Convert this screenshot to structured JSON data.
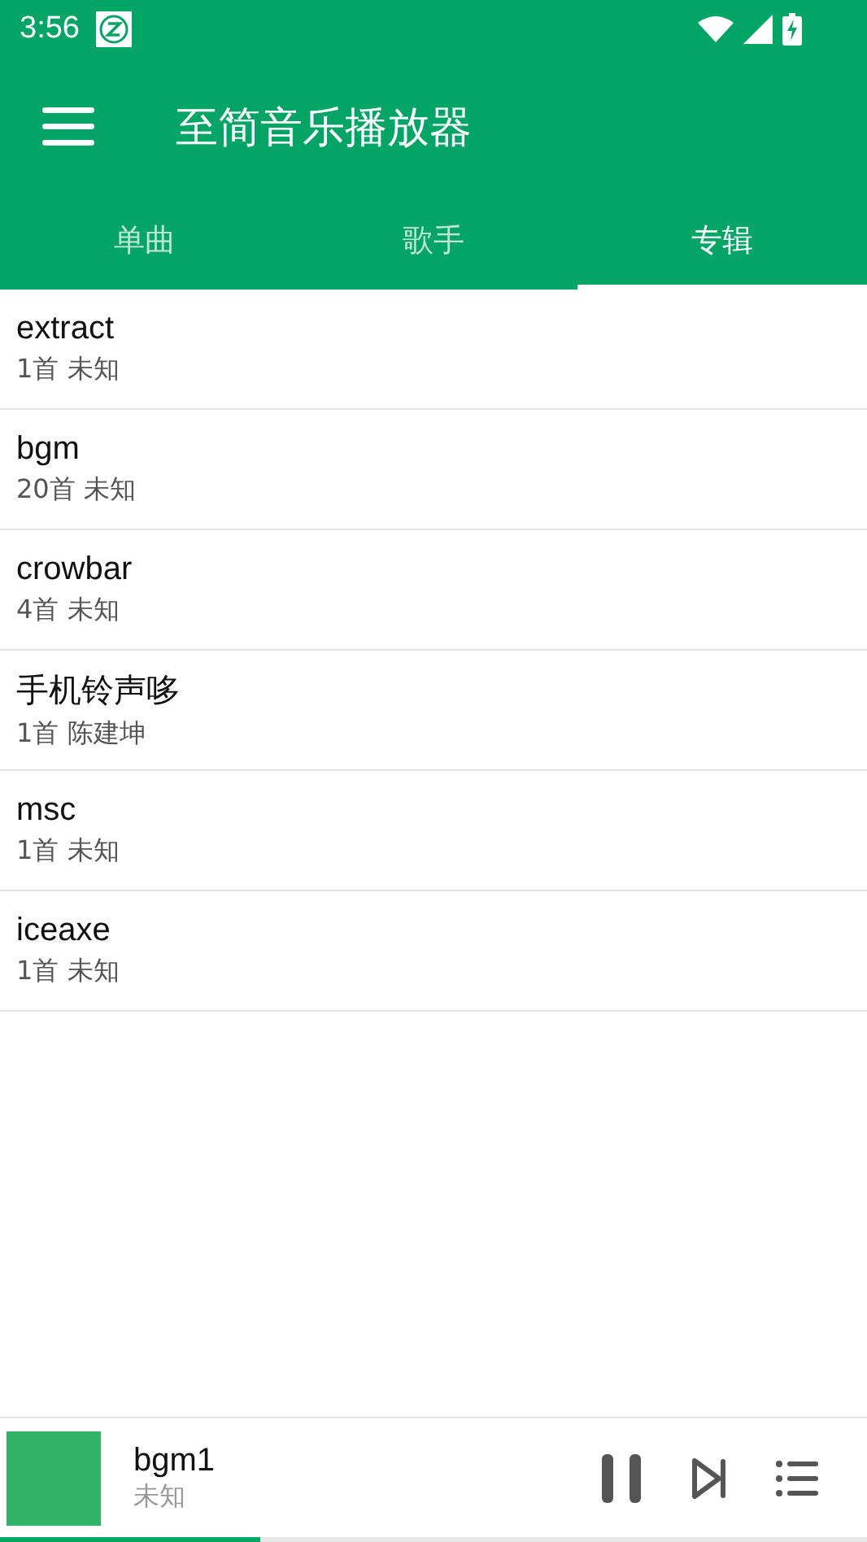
{
  "status_bar": {
    "time": "3:56"
  },
  "toolbar": {
    "title": "至简音乐播放器"
  },
  "tabs": [
    {
      "label": "单曲",
      "selected": false
    },
    {
      "label": "歌手",
      "selected": false
    },
    {
      "label": "专辑",
      "selected": true
    }
  ],
  "albums": [
    {
      "title": "extract",
      "subtitle": "1首 未知"
    },
    {
      "title": "bgm",
      "subtitle": "20首 未知"
    },
    {
      "title": "crowbar",
      "subtitle": "4首 未知"
    },
    {
      "title": "手机铃声哆",
      "subtitle": "1首 陈建坤"
    },
    {
      "title": "msc",
      "subtitle": "1首 未知"
    },
    {
      "title": "iceaxe",
      "subtitle": "1首 未知"
    }
  ],
  "player": {
    "title": "bgm1",
    "artist": "未知",
    "level": 0.3
  }
}
